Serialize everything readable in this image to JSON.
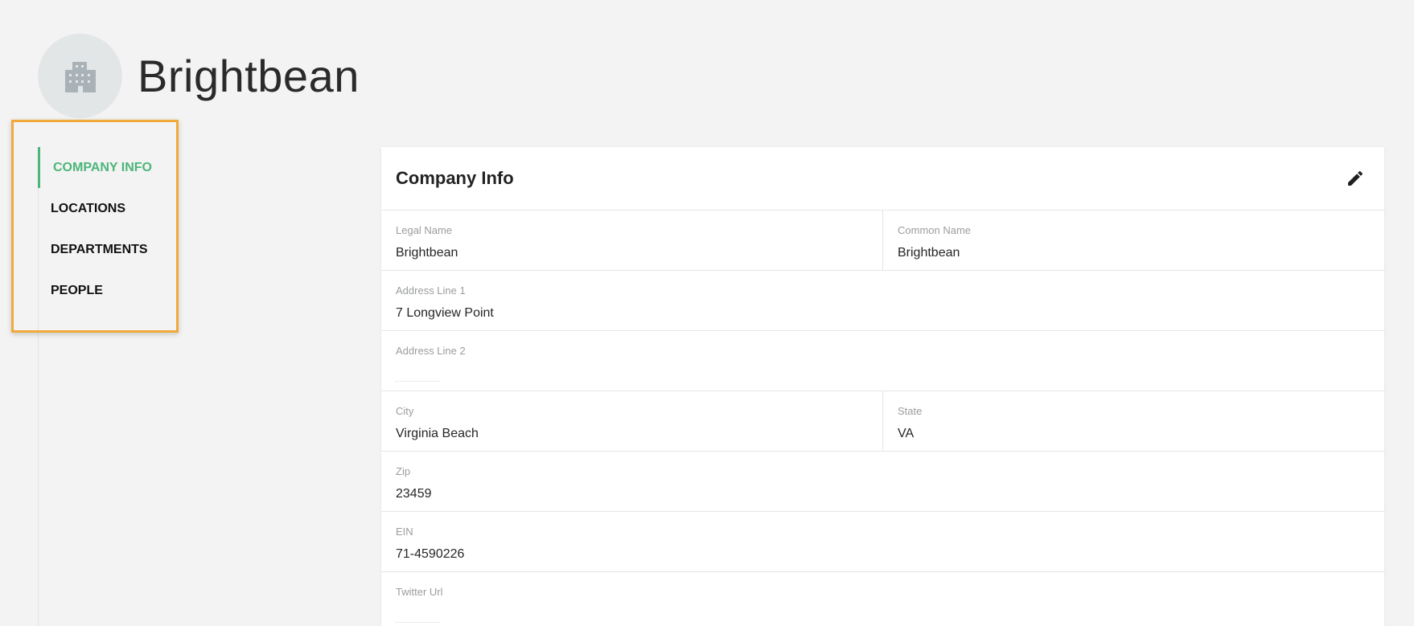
{
  "header": {
    "company_name": "Brightbean",
    "avatar_icon": "building-icon"
  },
  "sidebar": {
    "items": [
      {
        "label": "COMPANY INFO",
        "active": true
      },
      {
        "label": "LOCATIONS",
        "active": false
      },
      {
        "label": "DEPARTMENTS",
        "active": false
      },
      {
        "label": "PEOPLE",
        "active": false
      }
    ]
  },
  "card": {
    "title": "Company Info",
    "edit_icon": "pencil-icon",
    "fields": {
      "legal_name": {
        "label": "Legal Name",
        "value": "Brightbean"
      },
      "common_name": {
        "label": "Common Name",
        "value": "Brightbean"
      },
      "address_line_1": {
        "label": "Address Line 1",
        "value": "7 Longview Point"
      },
      "address_line_2": {
        "label": "Address Line 2",
        "value": ""
      },
      "city": {
        "label": "City",
        "value": "Virginia Beach"
      },
      "state": {
        "label": "State",
        "value": "VA"
      },
      "zip": {
        "label": "Zip",
        "value": "23459"
      },
      "ein": {
        "label": "EIN",
        "value": "71-4590226"
      },
      "twitter_url": {
        "label": "Twitter Url",
        "value": ""
      }
    }
  },
  "colors": {
    "accent": "#4cb57a",
    "highlight_border": "#f2a93b",
    "background": "#f2f3f2"
  }
}
